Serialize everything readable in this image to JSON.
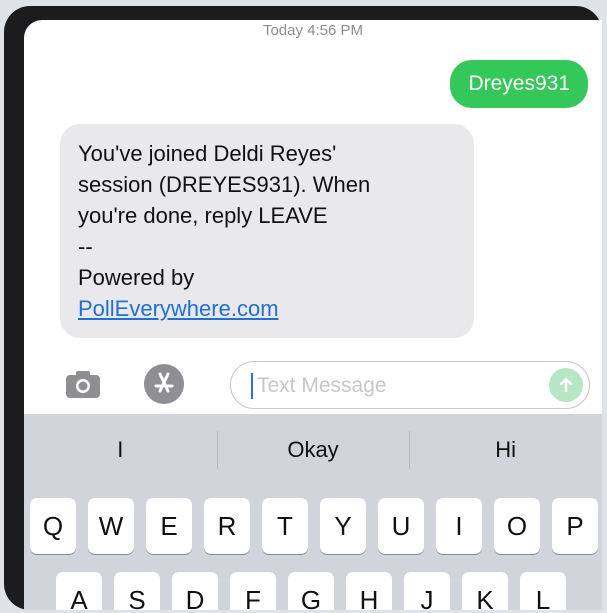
{
  "thread": {
    "timestamp": "Today 4:56 PM"
  },
  "messages": {
    "outgoing": {
      "text": "Dreyes931"
    },
    "incoming": {
      "line1": "You've joined Deldi Reyes'",
      "line2": "session (DREYES931). When",
      "line3": "you're done, reply LEAVE",
      "line4": "--",
      "line5": "Powered by",
      "link": "PollEverywhere.com"
    }
  },
  "input_bar": {
    "camera_icon": "camera-icon",
    "apps_icon": "app-store-icon",
    "placeholder": "Text Message",
    "send_icon": "arrow-up-icon"
  },
  "keyboard": {
    "suggestions": [
      "I",
      "Okay",
      "Hi"
    ],
    "row1": [
      "Q",
      "W",
      "E",
      "R",
      "T",
      "Y",
      "U",
      "I",
      "O",
      "P"
    ],
    "row2": [
      "A",
      "S",
      "D",
      "F",
      "G",
      "H",
      "J",
      "K",
      "L"
    ]
  },
  "colors": {
    "outgoing_bubble": "#34c759",
    "incoming_bubble": "#e9e9eb",
    "link": "#1f6fd6",
    "keyboard_bg": "#d1d4db"
  }
}
